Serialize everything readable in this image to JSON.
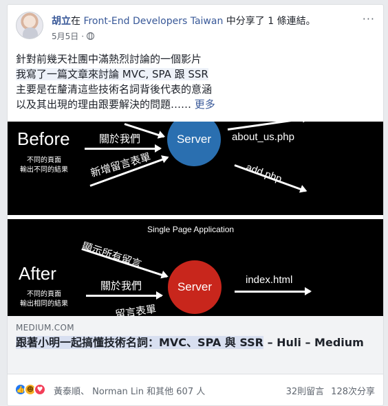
{
  "post": {
    "author": "胡立",
    "headline_mid": "在 ",
    "group": "Front-End Developers Taiwan",
    "headline_end": " 中分享了 1 條連結。",
    "date": "5月5日",
    "date_sep": "·",
    "more_icon": "···",
    "text_lines": [
      "針對前幾天社團中滿熱烈討論的一個影片",
      "我寫了一篇文章來討論 MVC, SPA 跟 SSR",
      "主要是在釐清這些技術名詞背後代表的意涵",
      "以及其出現的理由跟要解決的問題……"
    ],
    "see_more": "更多"
  },
  "image": {
    "before_label": "Before",
    "before_note": [
      "不同的頁面",
      "輸出不同的結果"
    ],
    "about_us": "關於我們",
    "add_comment": "新增留言表單",
    "server": "Server",
    "about_php": "about_us.php",
    "add_php": "add.php",
    "spa_title": "Single Page Application",
    "show_all": "顯示所有留言",
    "after_label": "After",
    "after_note": [
      "不同的頁面",
      "輸出相同的結果"
    ],
    "about_us_2": "關於我們",
    "add_comment_2": "留言表單",
    "index": "index.html"
  },
  "link": {
    "domain": "MEDIUM.COM",
    "title_main": "跟著小明一起搞懂技術名詞：MVC、SPA 與 SSR",
    "title_tail": " – Huli – Medium"
  },
  "footer": {
    "reactors": "黃泰順、 Norman Lin 和其他 607 人",
    "comments": "32則留言",
    "shares": "128次分享"
  },
  "colors": {
    "link_blue": "#385898",
    "server_blue": "#2a6fb0",
    "server_red": "#c8261c",
    "like": "#2078f4",
    "love": "#f33e58"
  }
}
